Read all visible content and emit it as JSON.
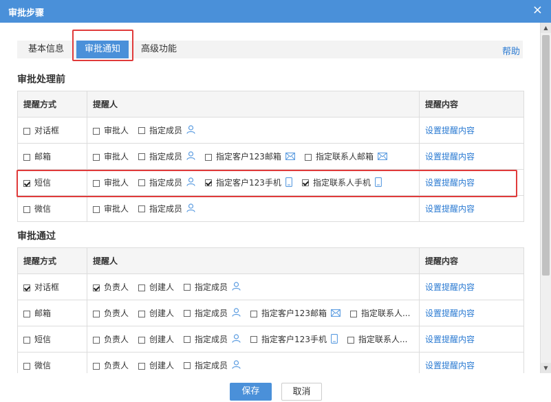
{
  "dialog": {
    "title": "审批步骤",
    "close_label": "×"
  },
  "tabs": [
    {
      "label": "基本信息",
      "active": false
    },
    {
      "label": "审批通知",
      "active": true
    },
    {
      "label": "高级功能",
      "active": false
    }
  ],
  "help_label": "帮助",
  "headers": {
    "method": "提醒方式",
    "recipients": "提醒人",
    "content": "提醒内容"
  },
  "link_label": "设置提醒内容",
  "section1": {
    "title": "审批处理前",
    "rows": [
      {
        "method": "对话框",
        "method_checked": false,
        "opts": [
          {
            "label": "审批人",
            "checked": false
          },
          {
            "label": "指定成员",
            "checked": false,
            "icon": "user-icon"
          }
        ]
      },
      {
        "method": "邮箱",
        "method_checked": false,
        "opts": [
          {
            "label": "审批人",
            "checked": false
          },
          {
            "label": "指定成员",
            "checked": false,
            "icon": "user-icon"
          },
          {
            "label": "指定客户123邮箱",
            "checked": false,
            "icon": "mail-icon"
          },
          {
            "label": "指定联系人邮箱",
            "checked": false,
            "icon": "mail-icon"
          }
        ]
      },
      {
        "method": "短信",
        "method_checked": true,
        "opts": [
          {
            "label": "审批人",
            "checked": false
          },
          {
            "label": "指定成员",
            "checked": false,
            "icon": "user-icon"
          },
          {
            "label": "指定客户123手机",
            "checked": true,
            "icon": "phone-icon"
          },
          {
            "label": "指定联系人手机",
            "checked": true,
            "icon": "phone-icon"
          }
        ]
      },
      {
        "method": "微信",
        "method_checked": false,
        "opts": [
          {
            "label": "审批人",
            "checked": false
          },
          {
            "label": "指定成员",
            "checked": false,
            "icon": "user-icon"
          }
        ]
      }
    ]
  },
  "section2": {
    "title": "审批通过",
    "rows": [
      {
        "method": "对话框",
        "method_checked": true,
        "opts": [
          {
            "label": "负责人",
            "checked": true
          },
          {
            "label": "创建人",
            "checked": false
          },
          {
            "label": "指定成员",
            "checked": false,
            "icon": "user-icon"
          }
        ]
      },
      {
        "method": "邮箱",
        "method_checked": false,
        "opts": [
          {
            "label": "负责人",
            "checked": false
          },
          {
            "label": "创建人",
            "checked": false
          },
          {
            "label": "指定成员",
            "checked": false,
            "icon": "user-icon"
          },
          {
            "label": "指定客户123邮箱",
            "checked": false,
            "icon": "mail-icon"
          },
          {
            "label": "指定联系人...",
            "checked": false
          }
        ]
      },
      {
        "method": "短信",
        "method_checked": false,
        "opts": [
          {
            "label": "负责人",
            "checked": false
          },
          {
            "label": "创建人",
            "checked": false
          },
          {
            "label": "指定成员",
            "checked": false,
            "icon": "user-icon"
          },
          {
            "label": "指定客户123手机",
            "checked": false,
            "icon": "phone-icon"
          },
          {
            "label": "指定联系人...",
            "checked": false
          }
        ]
      },
      {
        "method": "微信",
        "method_checked": false,
        "opts": [
          {
            "label": "负责人",
            "checked": false
          },
          {
            "label": "创建人",
            "checked": false
          },
          {
            "label": "指定成员",
            "checked": false,
            "icon": "user-icon"
          }
        ]
      }
    ]
  },
  "footer": {
    "save_label": "保存",
    "cancel_label": "取消"
  },
  "colors": {
    "accent": "#4a90d9",
    "link": "#2a7ad2",
    "highlight": "#e03a3a"
  }
}
